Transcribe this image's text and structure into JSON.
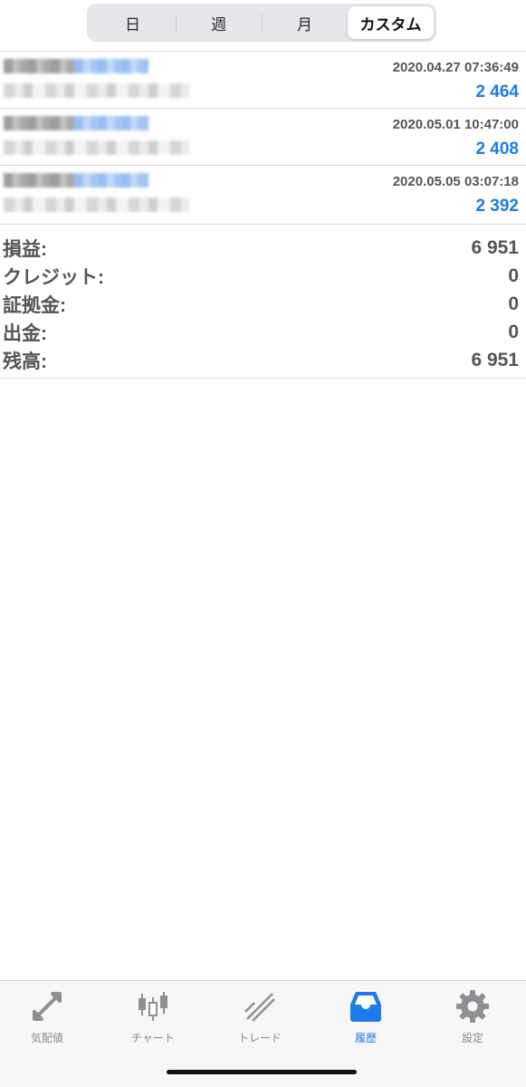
{
  "segments": [
    {
      "label": "日",
      "active": false
    },
    {
      "label": "週",
      "active": false
    },
    {
      "label": "月",
      "active": false
    },
    {
      "label": "カスタム",
      "active": true
    }
  ],
  "deals": [
    {
      "time": "2020.04.27 07:36:49",
      "profit": "2 464"
    },
    {
      "time": "2020.05.01 10:47:00",
      "profit": "2 408"
    },
    {
      "time": "2020.05.05 03:07:18",
      "profit": "2 392"
    }
  ],
  "summary": [
    {
      "label": "損益:",
      "value": "6 951"
    },
    {
      "label": "クレジット:",
      "value": "0"
    },
    {
      "label": "証拠金:",
      "value": "0"
    },
    {
      "label": "出金:",
      "value": "0"
    },
    {
      "label": "残高:",
      "value": "6 951"
    }
  ],
  "tabs": [
    {
      "label": "気配値",
      "icon": "quotes-icon",
      "active": false
    },
    {
      "label": "チャート",
      "icon": "chart-icon",
      "active": false
    },
    {
      "label": "トレード",
      "icon": "trade-icon",
      "active": false
    },
    {
      "label": "履歴",
      "icon": "history-icon",
      "active": true
    },
    {
      "label": "設定",
      "icon": "settings-icon",
      "active": false
    }
  ],
  "colors": {
    "accent": "#1e7be8",
    "icon_inactive": "#8e8e93"
  }
}
